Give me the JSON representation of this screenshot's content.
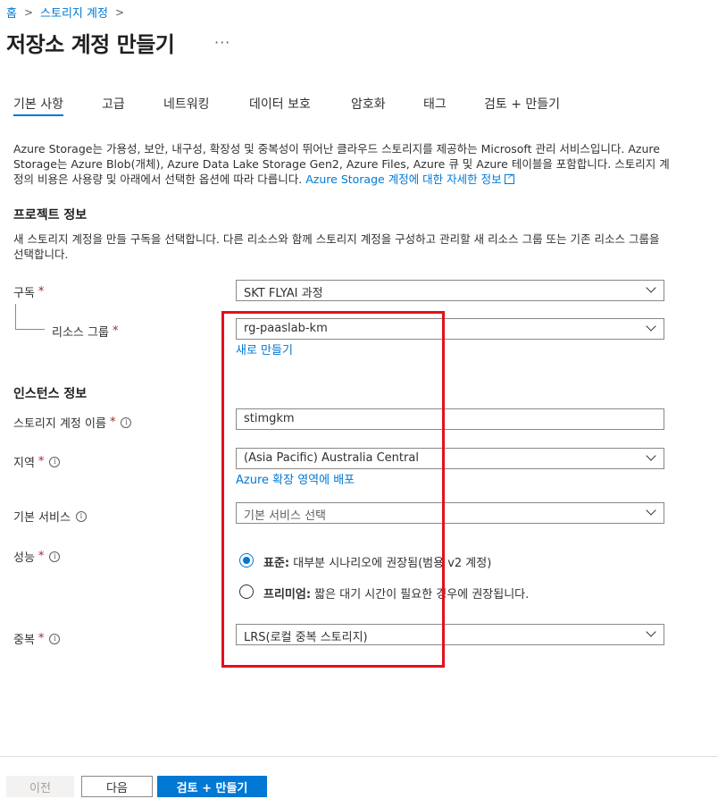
{
  "breadcrumb": {
    "home": "홈",
    "storage": "스토리지 계정"
  },
  "page_title": "저장소 계정 만들기",
  "more_label": "···",
  "tabs": [
    "기본 사항",
    "고급",
    "네트워킹",
    "데이터 보호",
    "암호화",
    "태그",
    "검토 + 만들기"
  ],
  "description": {
    "text": "Azure Storage는 가용성, 보안, 내구성, 확장성 및 중복성이 뛰어난 클라우드 스토리지를 제공하는 Microsoft 관리 서비스입니다. Azure Storage는 Azure Blob(개체), Azure Data Lake Storage Gen2, Azure Files, Azure 큐 및 Azure 테이블을 포함합니다. 스토리지 계정의 비용은 사용량 및 아래에서 선택한 옵션에 따라 다릅니다. ",
    "link": "Azure Storage 계정에 대한 자세한 정보"
  },
  "project": {
    "heading": "프로젝트 정보",
    "description": "새 스토리지 계정을 만들 구독을 선택합니다. 다른 리소스와 함께 스토리지 계정을 구성하고 관리할 새 리소스 그룹 또는 기존 리소스 그룹을 선택합니다.",
    "subscription_label": "구독",
    "subscription_value": "SKT FLYAI 과정",
    "resource_group_label": "리소스 그룹",
    "resource_group_value": "rg-paaslab-km",
    "create_new_link": "새로 만들기"
  },
  "instance": {
    "heading": "인스턴스 정보",
    "account_name_label": "스토리지 계정 이름",
    "account_name_value": "stimgkm",
    "region_label": "지역",
    "region_value": "(Asia Pacific) Australia Central",
    "edge_zone_link": "Azure 확장 영역에 배포",
    "primary_service_label": "기본 서비스",
    "primary_service_placeholder": "기본 서비스 선택",
    "performance_label": "성능",
    "performance_options": [
      {
        "title": "표준:",
        "desc": " 대부분 시나리오에 권장됨(범용 v2 계정)",
        "selected": true
      },
      {
        "title": "프리미엄:",
        "desc": " 짧은 대기 시간이 필요한 경우에 권장됩니다.",
        "selected": false
      }
    ],
    "redundancy_label": "중복",
    "redundancy_value": "LRS(로컬 중복 스토리지)"
  },
  "required_mark": "*",
  "info_glyph": "i",
  "buttons": {
    "prev": "이전",
    "next": "다음",
    "review_create": "검토 + 만들기"
  },
  "colors": {
    "accent": "#0078d4",
    "highlight_box": "#e3111b",
    "required": "#a4262c"
  }
}
